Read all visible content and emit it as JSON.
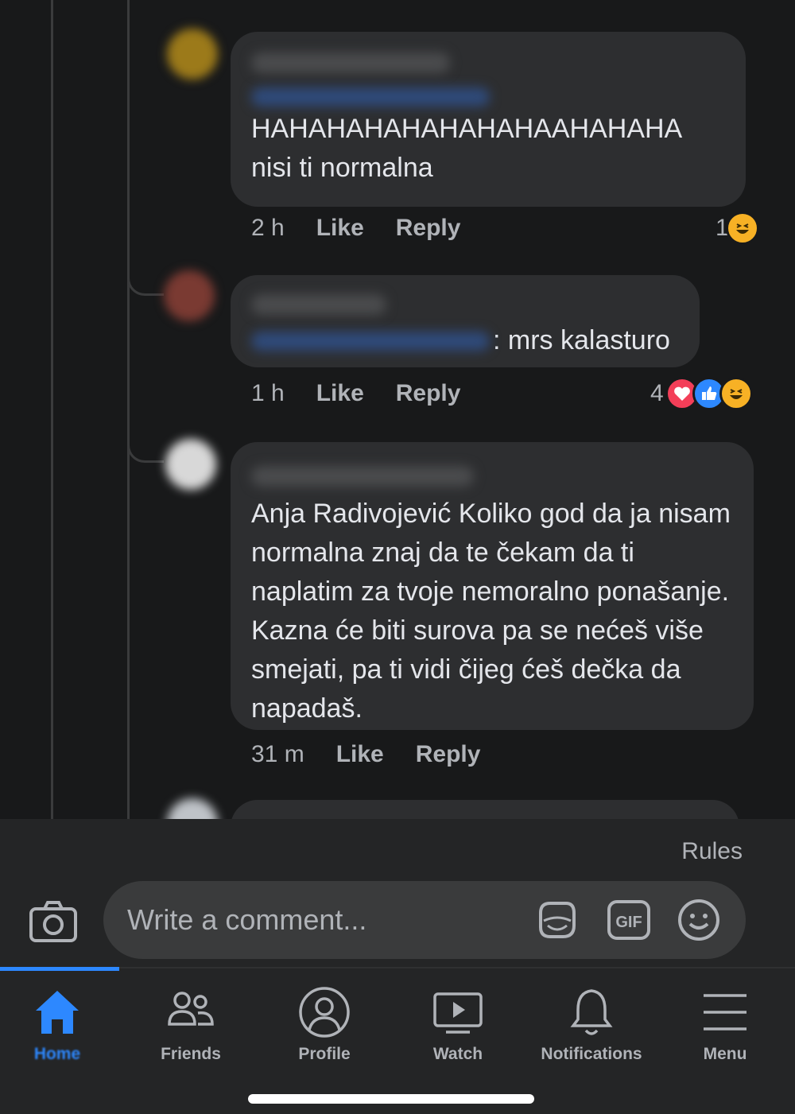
{
  "comments": [
    {
      "text": "HAHAHAHAHAHAHAHAAHAHAHA nisi ti normalna",
      "time": "2 h",
      "like_label": "Like",
      "reply_label": "Reply",
      "reaction_count": "1",
      "reactions": [
        "haha"
      ]
    },
    {
      "text": ": mrs kalasturo",
      "time": "1 h",
      "like_label": "Like",
      "reply_label": "Reply",
      "reaction_count": "4",
      "reactions": [
        "love",
        "like",
        "haha"
      ]
    },
    {
      "text": "Anja Radivojević Koliko god da ja nisam normalna znaj da te čekam da ti naplatim za tvoje nemoralno ponašanje. Kazna će biti surova pa se nećeš više smejati, pa ti vidi čijeg ćeš dečka da napadaš.",
      "time": "31 m",
      "like_label": "Like",
      "reply_label": "Reply"
    }
  ],
  "composer": {
    "rules_label": "Rules",
    "placeholder": "Write a comment...",
    "icons": [
      "camera-icon",
      "sticker-icon",
      "gif-icon",
      "emoji-icon"
    ]
  },
  "nav": {
    "items": [
      {
        "label": "Home",
        "icon": "home-icon",
        "active": true
      },
      {
        "label": "Friends",
        "icon": "friends-icon"
      },
      {
        "label": "Profile",
        "icon": "profile-icon"
      },
      {
        "label": "Watch",
        "icon": "watch-icon"
      },
      {
        "label": "Notifications",
        "icon": "bell-icon"
      },
      {
        "label": "Menu",
        "icon": "menu-icon"
      }
    ]
  },
  "colors": {
    "background": "#18191a",
    "bubble": "#2d2e30",
    "accent": "#2d88ff",
    "muted_text": "#b0b3b8",
    "love": "#f33e58",
    "haha": "#f7b125"
  }
}
